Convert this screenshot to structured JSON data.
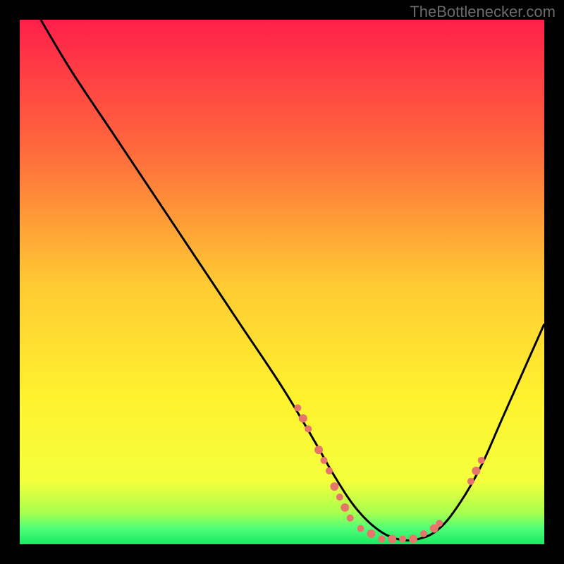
{
  "attribution": "TheBottlenecker.com",
  "chart_data": {
    "type": "line",
    "title": "",
    "xlabel": "",
    "ylabel": "",
    "xlim": [
      0,
      100
    ],
    "ylim": [
      0,
      100
    ],
    "gradient_stops": [
      {
        "offset": 0,
        "color": "#ff1f4a"
      },
      {
        "offset": 0.25,
        "color": "#ff6a3c"
      },
      {
        "offset": 0.5,
        "color": "#ffc933"
      },
      {
        "offset": 0.72,
        "color": "#fff22e"
      },
      {
        "offset": 0.88,
        "color": "#f4ff3c"
      },
      {
        "offset": 0.94,
        "color": "#a8ff4e"
      },
      {
        "offset": 0.97,
        "color": "#4eff78"
      },
      {
        "offset": 1.0,
        "color": "#18e860"
      }
    ],
    "series": [
      {
        "name": "bottleneck-curve",
        "x": [
          4,
          10,
          18,
          26,
          34,
          42,
          50,
          56,
          60,
          64,
          68,
          72,
          76,
          80,
          84,
          88,
          92,
          96,
          100
        ],
        "y": [
          100,
          90,
          78,
          66,
          54,
          42,
          30,
          20,
          13,
          7,
          3,
          1,
          1,
          3,
          8,
          15,
          24,
          33,
          42
        ]
      }
    ],
    "scatter_points": {
      "name": "highlighted-points",
      "color": "#e8756b",
      "points": [
        {
          "x": 53,
          "y": 26,
          "r": 5
        },
        {
          "x": 54,
          "y": 24,
          "r": 6
        },
        {
          "x": 55,
          "y": 22,
          "r": 5
        },
        {
          "x": 57,
          "y": 18,
          "r": 6
        },
        {
          "x": 58,
          "y": 16,
          "r": 5
        },
        {
          "x": 59,
          "y": 14,
          "r": 5
        },
        {
          "x": 60,
          "y": 11,
          "r": 6
        },
        {
          "x": 61,
          "y": 9,
          "r": 5
        },
        {
          "x": 62,
          "y": 7,
          "r": 6
        },
        {
          "x": 63,
          "y": 5,
          "r": 5
        },
        {
          "x": 65,
          "y": 3,
          "r": 5
        },
        {
          "x": 67,
          "y": 2,
          "r": 6
        },
        {
          "x": 69,
          "y": 1,
          "r": 5
        },
        {
          "x": 71,
          "y": 1,
          "r": 6
        },
        {
          "x": 73,
          "y": 1,
          "r": 5
        },
        {
          "x": 75,
          "y": 1,
          "r": 6
        },
        {
          "x": 77,
          "y": 2,
          "r": 5
        },
        {
          "x": 79,
          "y": 3,
          "r": 6
        },
        {
          "x": 80,
          "y": 4,
          "r": 5
        },
        {
          "x": 86,
          "y": 12,
          "r": 5
        },
        {
          "x": 87,
          "y": 14,
          "r": 6
        },
        {
          "x": 88,
          "y": 16,
          "r": 5
        }
      ]
    }
  }
}
